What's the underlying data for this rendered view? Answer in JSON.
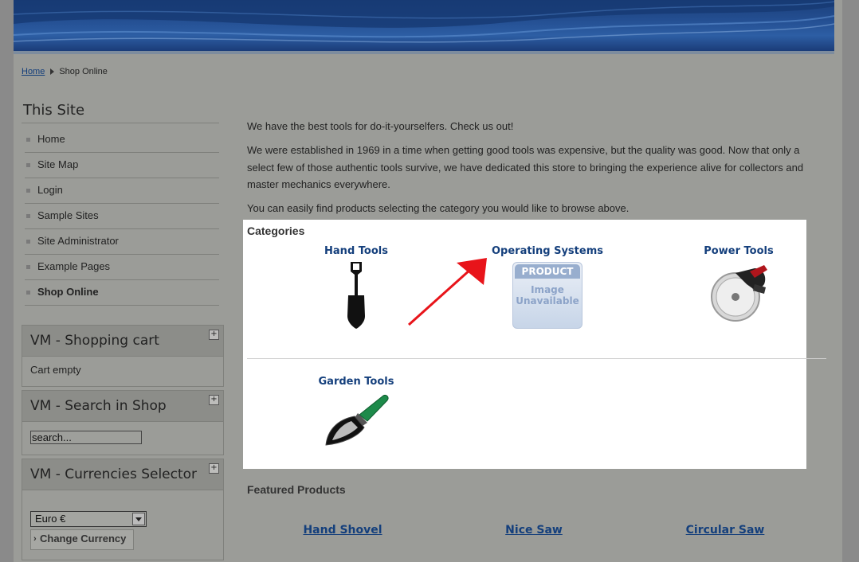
{
  "breadcrumb": {
    "home": "Home",
    "current": "Shop Online"
  },
  "site_menu": {
    "title": "This Site",
    "items": [
      {
        "label": "Home"
      },
      {
        "label": "Site Map"
      },
      {
        "label": "Login"
      },
      {
        "label": "Sample Sites"
      },
      {
        "label": "Site Administrator"
      },
      {
        "label": "Example Pages"
      },
      {
        "label": "Shop Online"
      }
    ]
  },
  "modules": {
    "cart": {
      "title": "VM - Shopping cart",
      "toggle": "+",
      "status": "Cart empty"
    },
    "search": {
      "title": "VM - Search in Shop",
      "toggle": "+",
      "value": "search..."
    },
    "currency": {
      "title": "VM - Currencies Selector",
      "toggle": "+",
      "selected": "Euro €",
      "button": "Change Currency"
    }
  },
  "content": {
    "intro": "We have the best tools for do-it-yourselfers. Check us out!",
    "history": "We were established in 1969 in a time when getting good tools was expensive, but the quality was good. Now that only a select few of those authentic tools survive, we have dedicated this store to bringing the experience alive for collectors and master mechanics everywhere.",
    "browse_hint": "You can easily find products selecting the category you would like to browse above."
  },
  "categories": {
    "title": "Categories",
    "items": [
      {
        "name": "Hand Tools",
        "icon": "shovel-icon"
      },
      {
        "name": "Operating Systems",
        "icon": "product-image-unavailable",
        "placeholder_line1": "PRODUCT",
        "placeholder_line2": "Image",
        "placeholder_line3": "Unavailable"
      },
      {
        "name": "Power Tools",
        "icon": "circular-saw-icon"
      },
      {
        "name": "Garden Tools",
        "icon": "trowel-icon"
      }
    ]
  },
  "featured": {
    "title": "Featured Products",
    "items": [
      {
        "name": "Hand Shovel"
      },
      {
        "name": "Nice Saw"
      },
      {
        "name": "Circular Saw"
      }
    ]
  },
  "colors": {
    "annotation_arrow": "#e8141a",
    "link": "#143f7c",
    "banner": "#244f92"
  }
}
